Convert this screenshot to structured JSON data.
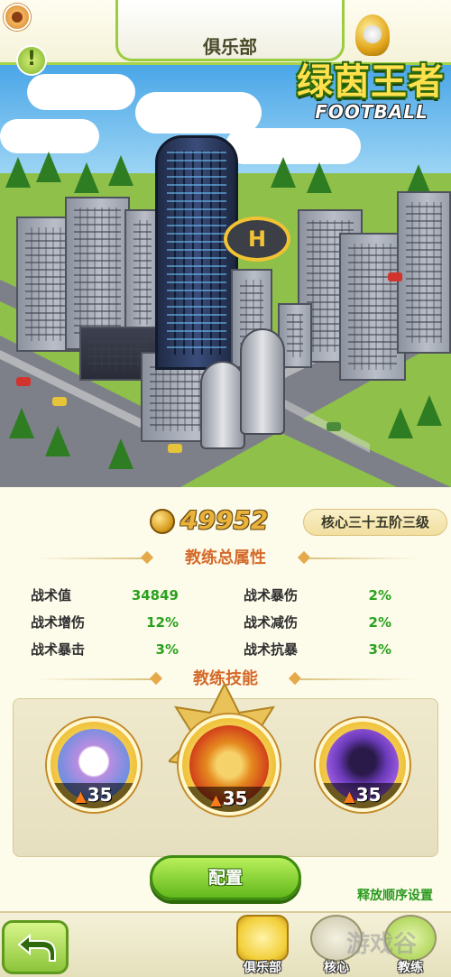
{
  "header": {
    "title": "俱乐部"
  },
  "logo": {
    "title": "绿茵王者",
    "subtitle": "FOOTBALL"
  },
  "alert": {
    "symbol": "!"
  },
  "helipad": {
    "symbol": "H"
  },
  "club": {
    "coins": "49952",
    "rank": "核心三十五阶三级"
  },
  "coach_attributes": {
    "heading": "教练总属性",
    "left": [
      {
        "label": "战术值",
        "value": "34849"
      },
      {
        "label": "战术增伤",
        "value": "12%"
      },
      {
        "label": "战术暴击",
        "value": "3%"
      }
    ],
    "right": [
      {
        "label": "战术暴伤",
        "value": "2%"
      },
      {
        "label": "战术减伤",
        "value": "2%"
      },
      {
        "label": "战术抗暴",
        "value": "3%"
      }
    ]
  },
  "coach_skills": {
    "heading": "教练技能",
    "items": [
      {
        "level": "35",
        "icon": "jersey-icon"
      },
      {
        "level": "35",
        "icon": "fire-football-icon"
      },
      {
        "level": "35",
        "icon": "shadow-cat-icon"
      }
    ]
  },
  "buttons": {
    "config": "配置",
    "release_order": "释放顺序设置"
  },
  "bottom_nav": {
    "items": [
      {
        "label": "俱乐部",
        "icon": "clubhouse-icon",
        "active": true
      },
      {
        "label": "核心",
        "icon": "core-emblem-icon",
        "active": false
      },
      {
        "label": "教练",
        "icon": "coach-icon",
        "active": false
      }
    ],
    "watermark": "游戏谷"
  },
  "colors": {
    "accent_green": "#62b81c",
    "value_green": "#2aa21e",
    "heading_orange": "#d46a2a",
    "coin_gold": "#e9b23a"
  }
}
